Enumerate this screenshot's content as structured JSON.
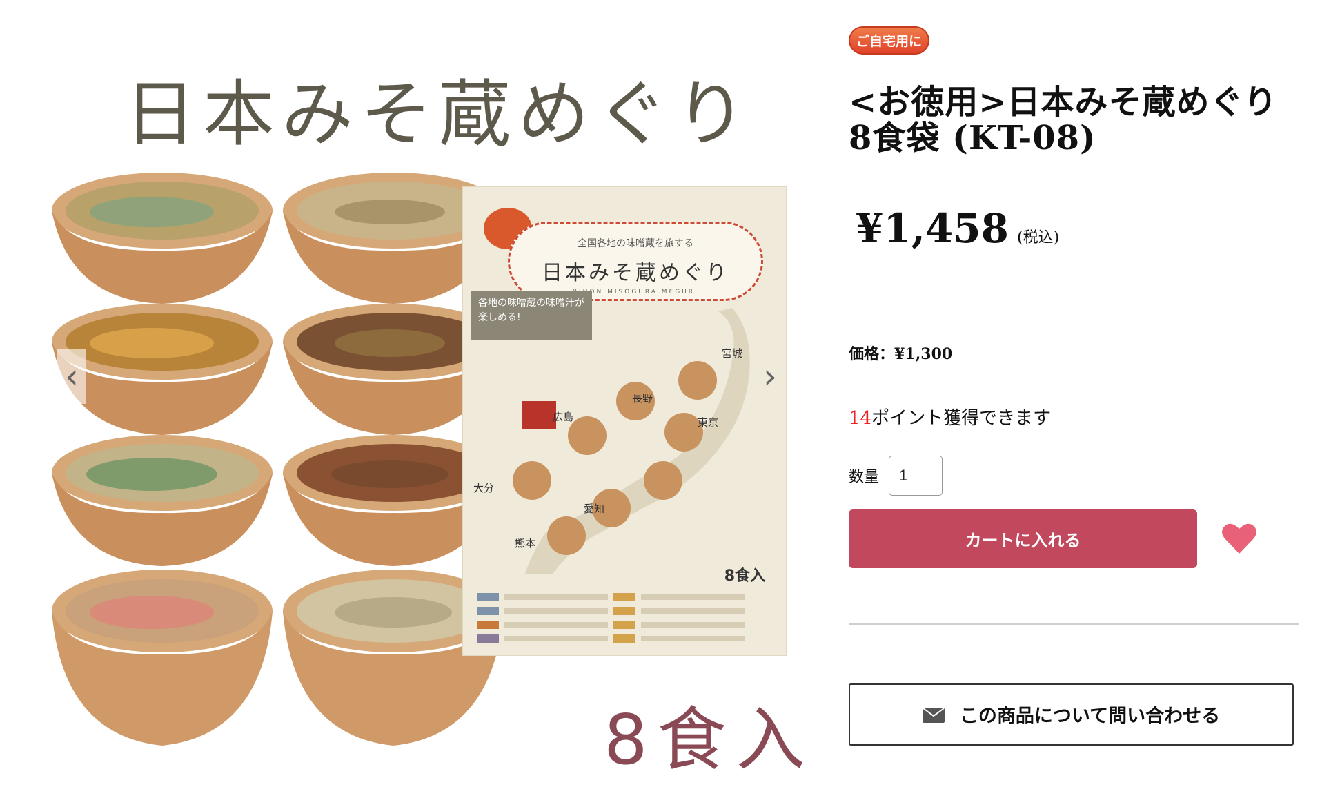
{
  "gallery": {
    "main_image_title": "日本みそ蔵めぐり",
    "count_overlay": "8食入",
    "package": {
      "tagline": "全国各地の味噌蔵を旅する",
      "title": "日本みそ蔵めぐり",
      "romaji": "NIHON MISOGURA MEGURI",
      "banner": "各地の味噌蔵の味噌汁が楽しめる!",
      "count": "8食入",
      "cities": [
        "宮城",
        "長野",
        "広島",
        "東京",
        "大分",
        "愛知",
        "熊本"
      ]
    },
    "prev_icon": "chevron-left-icon",
    "next_icon": "chevron-right-icon"
  },
  "product": {
    "badge": "ご自宅用に",
    "title": "<お徳用>日本みそ蔵めぐり 8食袋 (KT-08)",
    "price": "¥1,458",
    "tax_note": "(税込)",
    "base_price_label": "価格：",
    "base_price": "¥1,300",
    "points_number": "14",
    "points_text": "ポイント獲得できます",
    "quantity_label": "数量",
    "quantity_value": "1",
    "cart_button": "カートに入れる",
    "favorite_icon": "heart-icon",
    "contact_button": "この商品について問い合わせる",
    "contact_icon": "mail-icon"
  },
  "colors": {
    "cart_button": "#c2495d",
    "heart": "#e86178",
    "badge": "#e0432a",
    "points_number": "#ee2222"
  }
}
